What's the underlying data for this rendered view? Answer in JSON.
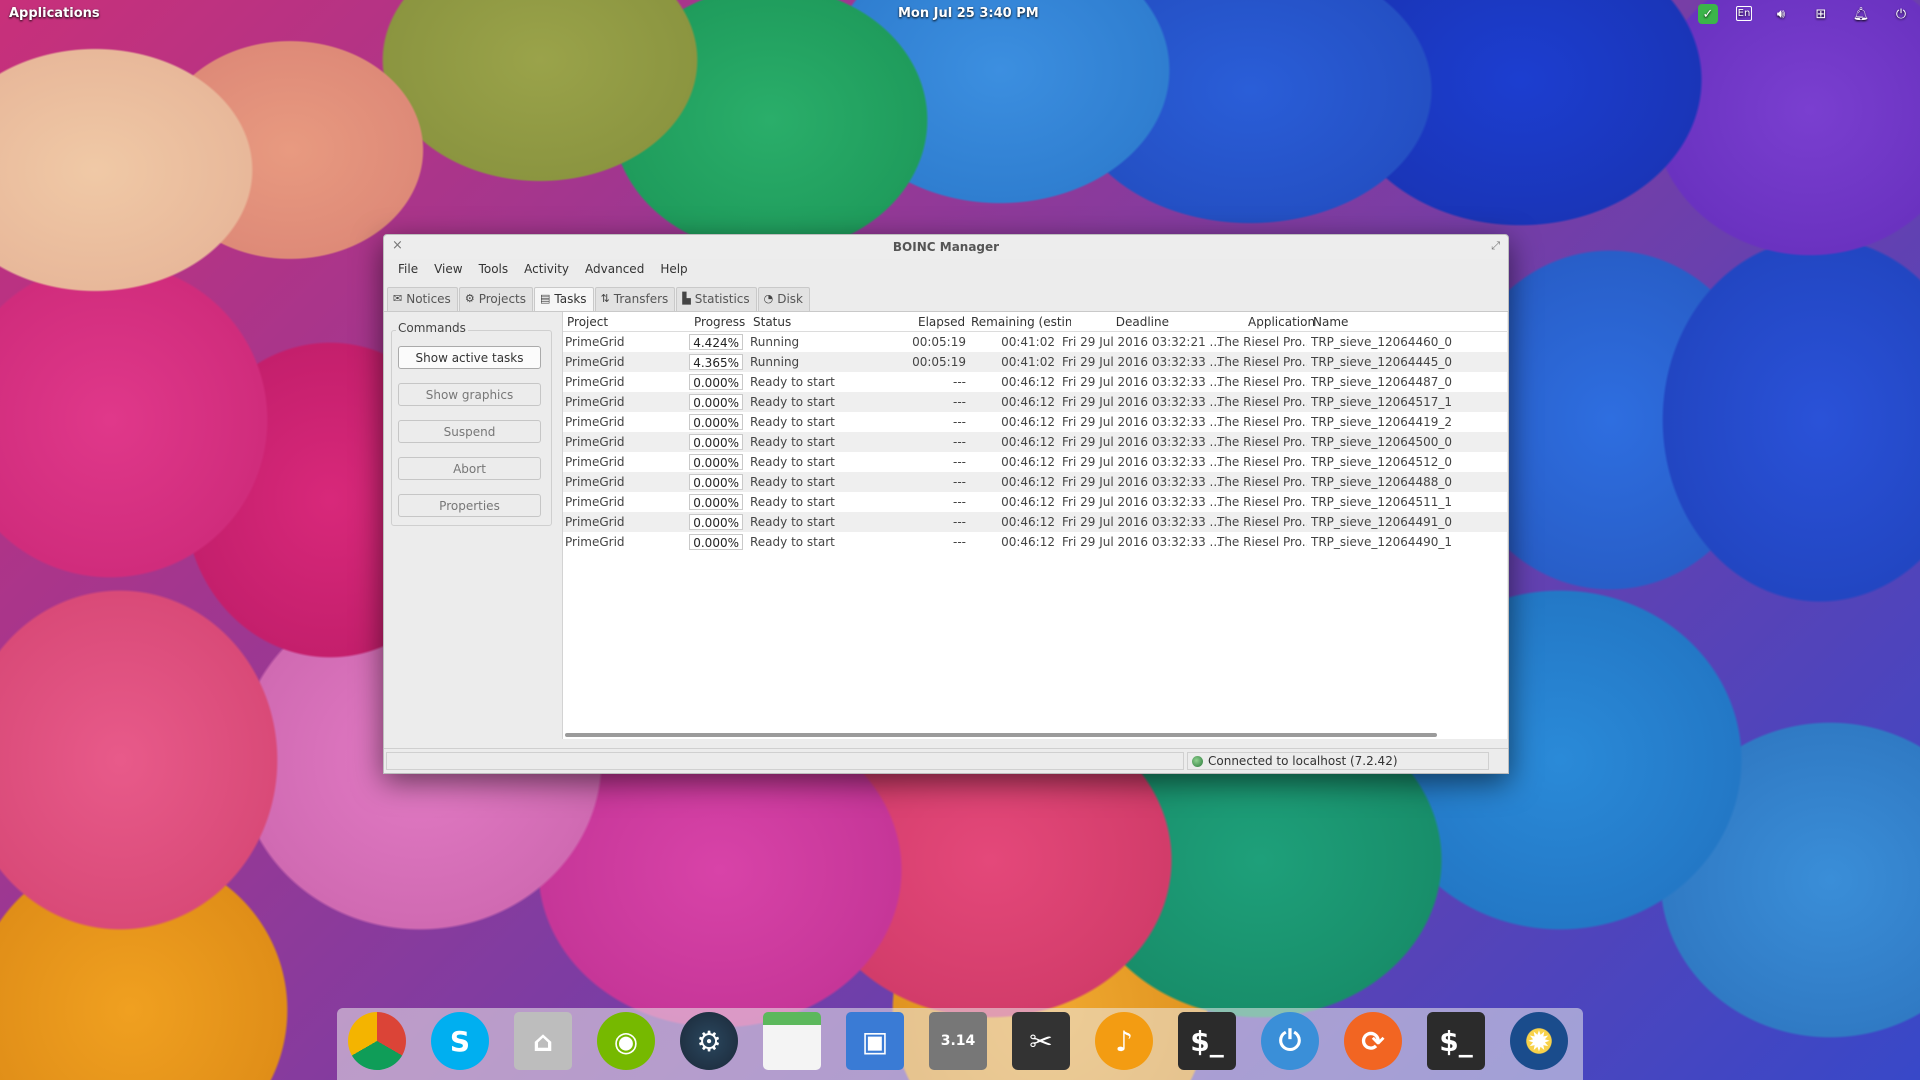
{
  "top_panel": {
    "applications_label": "Applications",
    "clock": "Mon Jul 25    3:40 PM",
    "tray": {
      "keyboard_layout": "En"
    }
  },
  "window": {
    "title": "BOINC Manager",
    "menu": [
      "File",
      "View",
      "Tools",
      "Activity",
      "Advanced",
      "Help"
    ],
    "tabs": [
      {
        "label": "Notices",
        "icon": "envelope-icon",
        "active": false
      },
      {
        "label": "Projects",
        "icon": "gear-icon",
        "active": false
      },
      {
        "label": "Tasks",
        "icon": "document-icon",
        "active": true
      },
      {
        "label": "Transfers",
        "icon": "transfer-icon",
        "active": false
      },
      {
        "label": "Statistics",
        "icon": "chart-icon",
        "active": false
      },
      {
        "label": "Disk",
        "icon": "pie-icon",
        "active": false
      }
    ],
    "commands": {
      "label": "Commands",
      "buttons": [
        {
          "label": "Show active tasks",
          "enabled": true
        },
        {
          "label": "Show graphics",
          "enabled": false
        },
        {
          "label": "Suspend",
          "enabled": false
        },
        {
          "label": "Abort",
          "enabled": false
        },
        {
          "label": "Properties",
          "enabled": false
        }
      ]
    },
    "table": {
      "columns": [
        "Project",
        "Progress",
        "Status",
        "Elapsed",
        "Remaining (estim",
        "Deadline",
        "Application",
        "Name"
      ],
      "rows": [
        {
          "project": "PrimeGrid",
          "progress": "4.424%",
          "status": "Running",
          "elapsed": "00:05:19",
          "remaining": "00:41:02",
          "deadline": "Fri 29 Jul 2016 03:32:21 ...",
          "application": "The Riesel Pro...",
          "name": "TRP_sieve_12064460_0"
        },
        {
          "project": "PrimeGrid",
          "progress": "4.365%",
          "status": "Running",
          "elapsed": "00:05:19",
          "remaining": "00:41:02",
          "deadline": "Fri 29 Jul 2016 03:32:33 ...",
          "application": "The Riesel Pro...",
          "name": "TRP_sieve_12064445_0"
        },
        {
          "project": "PrimeGrid",
          "progress": "0.000%",
          "status": "Ready to start",
          "elapsed": "---",
          "remaining": "00:46:12",
          "deadline": "Fri 29 Jul 2016 03:32:33 ...",
          "application": "The Riesel Pro...",
          "name": "TRP_sieve_12064487_0"
        },
        {
          "project": "PrimeGrid",
          "progress": "0.000%",
          "status": "Ready to start",
          "elapsed": "---",
          "remaining": "00:46:12",
          "deadline": "Fri 29 Jul 2016 03:32:33 ...",
          "application": "The Riesel Pro...",
          "name": "TRP_sieve_12064517_1"
        },
        {
          "project": "PrimeGrid",
          "progress": "0.000%",
          "status": "Ready to start",
          "elapsed": "---",
          "remaining": "00:46:12",
          "deadline": "Fri 29 Jul 2016 03:32:33 ...",
          "application": "The Riesel Pro...",
          "name": "TRP_sieve_12064419_2"
        },
        {
          "project": "PrimeGrid",
          "progress": "0.000%",
          "status": "Ready to start",
          "elapsed": "---",
          "remaining": "00:46:12",
          "deadline": "Fri 29 Jul 2016 03:32:33 ...",
          "application": "The Riesel Pro...",
          "name": "TRP_sieve_12064500_0"
        },
        {
          "project": "PrimeGrid",
          "progress": "0.000%",
          "status": "Ready to start",
          "elapsed": "---",
          "remaining": "00:46:12",
          "deadline": "Fri 29 Jul 2016 03:32:33 ...",
          "application": "The Riesel Pro...",
          "name": "TRP_sieve_12064512_0"
        },
        {
          "project": "PrimeGrid",
          "progress": "0.000%",
          "status": "Ready to start",
          "elapsed": "---",
          "remaining": "00:46:12",
          "deadline": "Fri 29 Jul 2016 03:32:33 ...",
          "application": "The Riesel Pro...",
          "name": "TRP_sieve_12064488_0"
        },
        {
          "project": "PrimeGrid",
          "progress": "0.000%",
          "status": "Ready to start",
          "elapsed": "---",
          "remaining": "00:46:12",
          "deadline": "Fri 29 Jul 2016 03:32:33 ...",
          "application": "The Riesel Pro...",
          "name": "TRP_sieve_12064511_1"
        },
        {
          "project": "PrimeGrid",
          "progress": "0.000%",
          "status": "Ready to start",
          "elapsed": "---",
          "remaining": "00:46:12",
          "deadline": "Fri 29 Jul 2016 03:32:33 ...",
          "application": "The Riesel Pro...",
          "name": "TRP_sieve_12064491_0"
        },
        {
          "project": "PrimeGrid",
          "progress": "0.000%",
          "status": "Ready to start",
          "elapsed": "---",
          "remaining": "00:46:12",
          "deadline": "Fri 29 Jul 2016 03:32:33 ...",
          "application": "The Riesel Pro...",
          "name": "TRP_sieve_12064490_1"
        }
      ]
    },
    "statusbar": {
      "connection": "Connected to localhost (7.2.42)"
    }
  },
  "dock": {
    "items": [
      {
        "name": "chrome-icon",
        "color": "#e94235",
        "glyph": ""
      },
      {
        "name": "skype-icon",
        "color": "#00aff0",
        "glyph": "S"
      },
      {
        "name": "home-folder-icon",
        "color": "#bdbdbd",
        "glyph": "⌂"
      },
      {
        "name": "nvidia-icon",
        "color": "#76b900",
        "glyph": "◉"
      },
      {
        "name": "steam-icon",
        "color": "#1b2838",
        "glyph": "⚙"
      },
      {
        "name": "calendar-icon",
        "color": "#5cb85c",
        "glyph": ""
      },
      {
        "name": "image-viewer-icon",
        "color": "#3a7bd5",
        "glyph": "▣"
      },
      {
        "name": "calculator-icon",
        "color": "#777777",
        "glyph": "3.14"
      },
      {
        "name": "screenshot-icon",
        "color": "#333333",
        "glyph": "✂"
      },
      {
        "name": "music-icon",
        "color": "#f39c12",
        "glyph": "♪"
      },
      {
        "name": "terminal-icon",
        "color": "#2b2b2b",
        "glyph": "$_"
      },
      {
        "name": "switchboard-icon",
        "color": "#3a8fd8",
        "glyph": "⏻"
      },
      {
        "name": "update-icon",
        "color": "#f26522",
        "glyph": "⟳"
      },
      {
        "name": "terminal-icon-2",
        "color": "#2b2b2b",
        "glyph": "$_"
      },
      {
        "name": "boinc-icon",
        "color": "#1a4c8c",
        "glyph": "✹"
      }
    ]
  }
}
